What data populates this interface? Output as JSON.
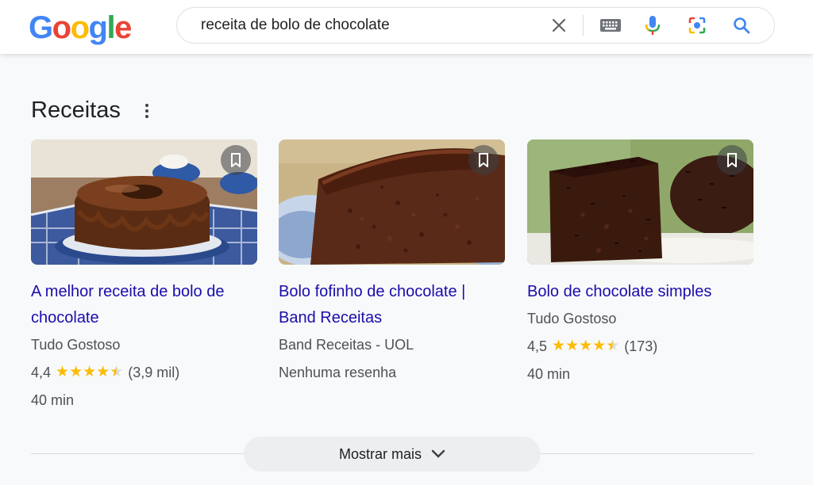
{
  "logo": {
    "letters": [
      "G",
      "o",
      "o",
      "g",
      "l",
      "e"
    ],
    "colors": [
      "#4285F4",
      "#EA4335",
      "#FBBC05",
      "#4285F4",
      "#34A853",
      "#EA4335"
    ]
  },
  "search": {
    "query": "receita de bolo de chocolate",
    "icons": [
      "clear-icon",
      "keyboard-icon",
      "microphone-icon",
      "lens-icon",
      "search-icon"
    ]
  },
  "section": {
    "title": "Receitas"
  },
  "cards": [
    {
      "title_line1": "A melhor receita de bolo de",
      "title_line2": "chocolate",
      "source": "Tudo Gostoso",
      "rating": "4,4",
      "rating_value": 4.4,
      "reviews": "(3,9 mil)",
      "time": "40 min"
    },
    {
      "title_line1": "Bolo fofinho de chocolate |",
      "title_line2": "Band Receitas",
      "source": "Band Receitas - UOL",
      "no_reviews": "Nenhuma resenha"
    },
    {
      "title_line1": "Bolo de chocolate simples",
      "source": "Tudo Gostoso",
      "rating": "4,5",
      "rating_value": 4.5,
      "reviews": "(173)",
      "time": "40 min"
    }
  ],
  "footer": {
    "show_more": "Mostrar mais"
  },
  "colors": {
    "link": "#1a0dab",
    "star": "#fbbc04",
    "accent_blue": "#4285F4"
  }
}
